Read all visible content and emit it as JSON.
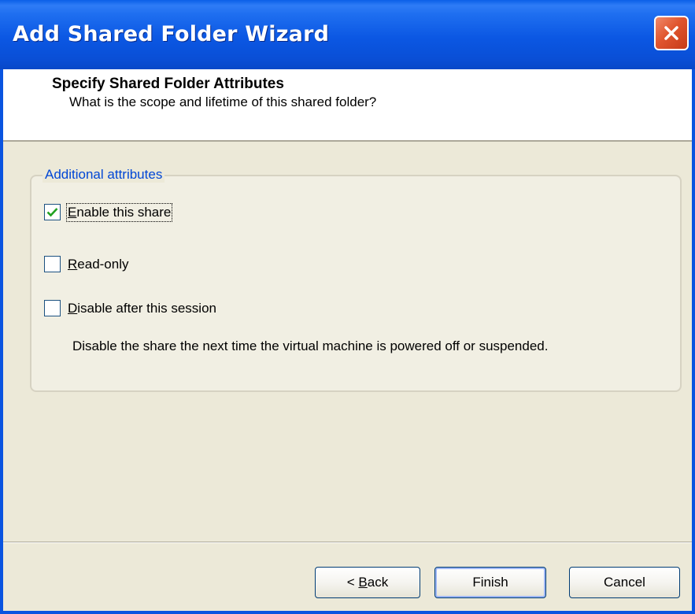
{
  "window": {
    "title": "Add Shared Folder Wizard"
  },
  "header": {
    "title": "Specify Shared Folder Attributes",
    "subtitle": "What is the scope and lifetime of this shared folder?"
  },
  "group": {
    "legend": "Additional attributes",
    "options": [
      {
        "mnemonic": "E",
        "rest": "nable this share",
        "checked": true
      },
      {
        "mnemonic": "R",
        "rest": "ead-only",
        "checked": false
      },
      {
        "mnemonic": "D",
        "rest": "isable after this session",
        "checked": false
      }
    ],
    "description": "Disable the share the next time the virtual machine is powered off or suspended."
  },
  "buttons": {
    "back_prefix": "< ",
    "back_mnemonic": "B",
    "back_rest": "ack",
    "finish": "Finish",
    "cancel": "Cancel"
  },
  "colors": {
    "titlebar": "#0a54e0",
    "legend_text": "#0046d5",
    "checkmark": "#21a121",
    "face": "#ece9d8"
  },
  "icons": {
    "close": "close-icon",
    "check": "checkmark-icon"
  }
}
